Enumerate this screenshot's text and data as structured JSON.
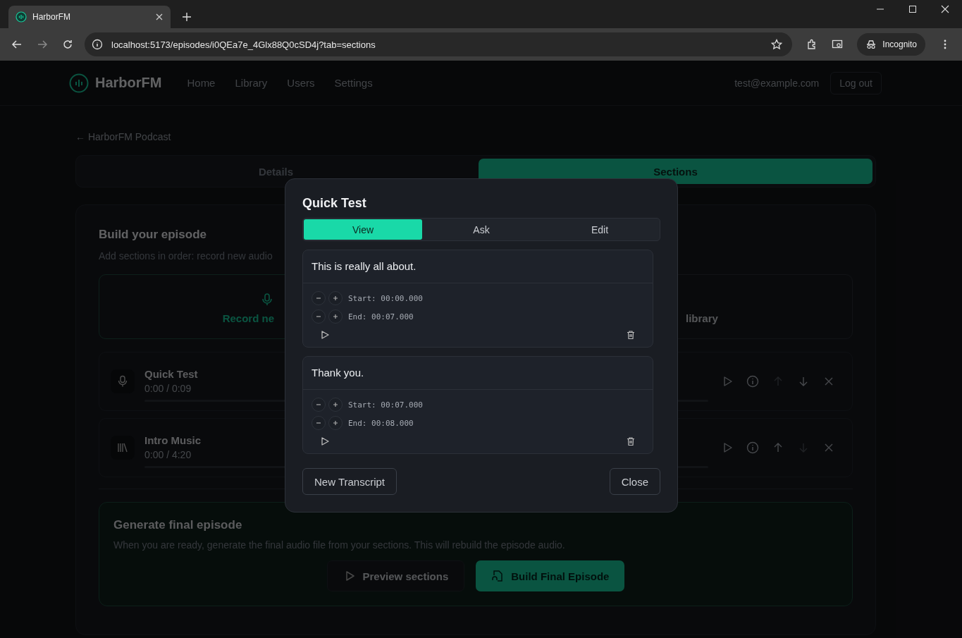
{
  "browser": {
    "tab_title": "HarborFM",
    "url": "localhost:5173/episodes/i0QEa7e_4Glx88Q0cSD4j?tab=sections",
    "profile": "Incognito"
  },
  "header": {
    "logo": "HarborFM",
    "nav": [
      {
        "label": "Home"
      },
      {
        "label": "Library"
      },
      {
        "label": "Users"
      },
      {
        "label": "Settings"
      }
    ],
    "email": "test@example.com",
    "logout": "Log out"
  },
  "back_link": "← HarborFM Podcast",
  "tabs": [
    {
      "label": "Details",
      "selected": false
    },
    {
      "label": "Sections",
      "selected": true
    }
  ],
  "build": {
    "title": "Build your episode",
    "subtitle": "Add sections in order: record new audio",
    "add_options": [
      {
        "kind": "record",
        "label": "Record ne"
      },
      {
        "kind": "library",
        "label": "library"
      }
    ],
    "sections": [
      {
        "kind": "recording",
        "title": "Quick Test",
        "time": "0:00 / 0:09",
        "actions": [
          {
            "kind": "play",
            "disabled": false
          },
          {
            "kind": "info",
            "disabled": false
          },
          {
            "kind": "up",
            "disabled": true
          },
          {
            "kind": "down",
            "disabled": false
          },
          {
            "kind": "remove",
            "disabled": false
          }
        ]
      },
      {
        "kind": "library",
        "title": "Intro Music",
        "time": "0:00 / 4:20",
        "actions": [
          {
            "kind": "play",
            "disabled": false
          },
          {
            "kind": "info",
            "disabled": false
          },
          {
            "kind": "up",
            "disabled": false
          },
          {
            "kind": "down",
            "disabled": true
          },
          {
            "kind": "remove",
            "disabled": false
          }
        ]
      }
    ]
  },
  "generate": {
    "title": "Generate final episode",
    "text": "When you are ready, generate the final audio file from your sections. This will rebuild the episode audio.",
    "preview": "Preview sections",
    "build": "Build Final Episode"
  },
  "modal": {
    "title": "Quick Test",
    "tabs": [
      {
        "label": "View",
        "selected": true
      },
      {
        "label": "Ask",
        "selected": false
      },
      {
        "label": "Edit",
        "selected": false
      }
    ],
    "segments": [
      {
        "text": "This is really all about.",
        "start": "Start: 00:00.000",
        "end": "End: 00:07.000"
      },
      {
        "text": "Thank you.",
        "start": "Start: 00:07.000",
        "end": "End: 00:08.000"
      }
    ],
    "new_transcript": "New Transcript",
    "close": "Close"
  }
}
